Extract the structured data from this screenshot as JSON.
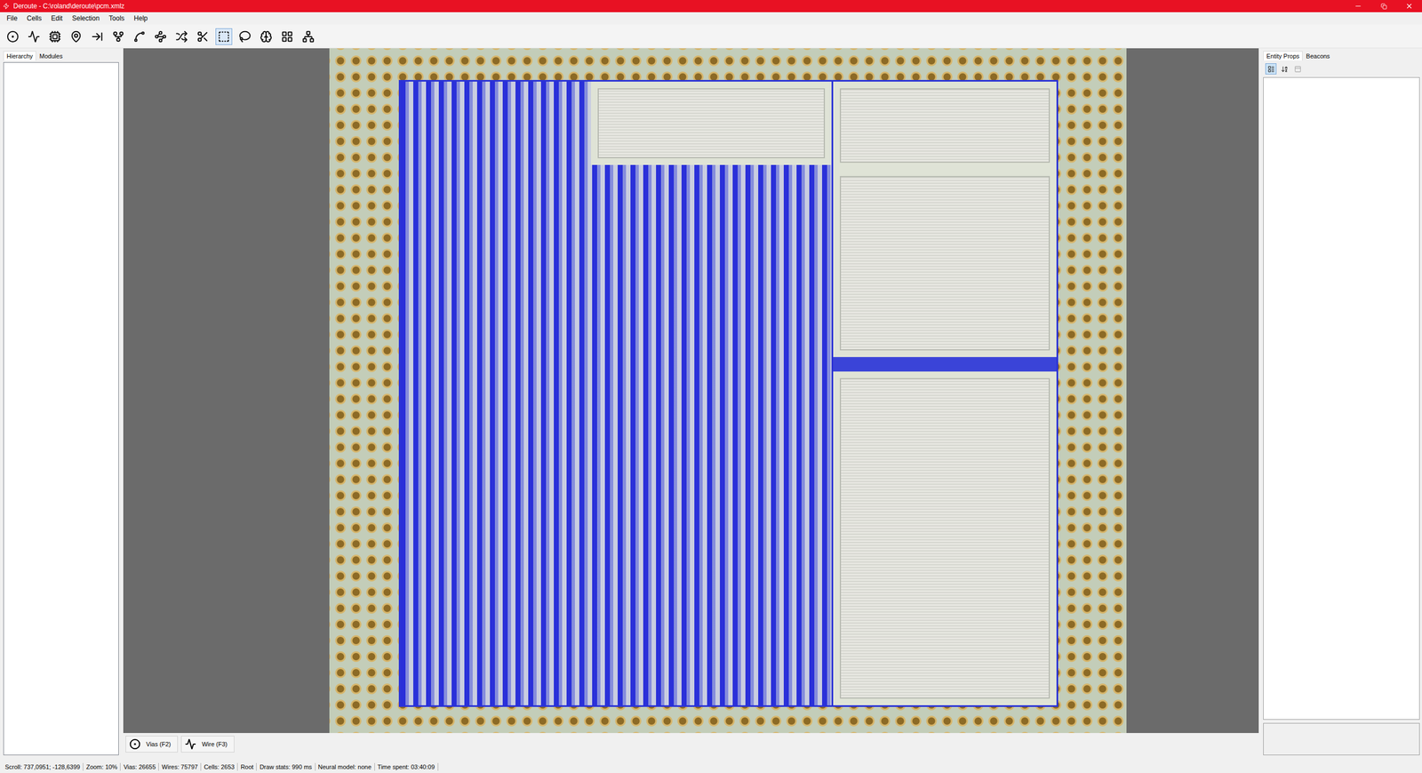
{
  "window": {
    "title": "Deroute - C:\\roland\\deroute\\pcm.xmlz"
  },
  "menu": [
    "File",
    "Cells",
    "Edit",
    "Selection",
    "Tools",
    "Help"
  ],
  "left_tabs": [
    {
      "label": "Hierarchy",
      "selected": true
    },
    {
      "label": "Modules",
      "selected": false
    }
  ],
  "right_tabs": [
    {
      "label": "Entity Props",
      "selected": true
    },
    {
      "label": "Beacons",
      "selected": false
    }
  ],
  "layer_buttons": [
    {
      "label": "Vias (F2)"
    },
    {
      "label": "Wire (F3)"
    }
  ],
  "status_bar": [
    "Scroll: 737,0951; -128,6399",
    "Zoom: 10%",
    "Vias: 26655",
    "Wires: 75797",
    "Cells: 2653",
    "Root",
    "Draw stats: 990 ms",
    "Neural model: none",
    "Time spent: 03:40:09"
  ]
}
